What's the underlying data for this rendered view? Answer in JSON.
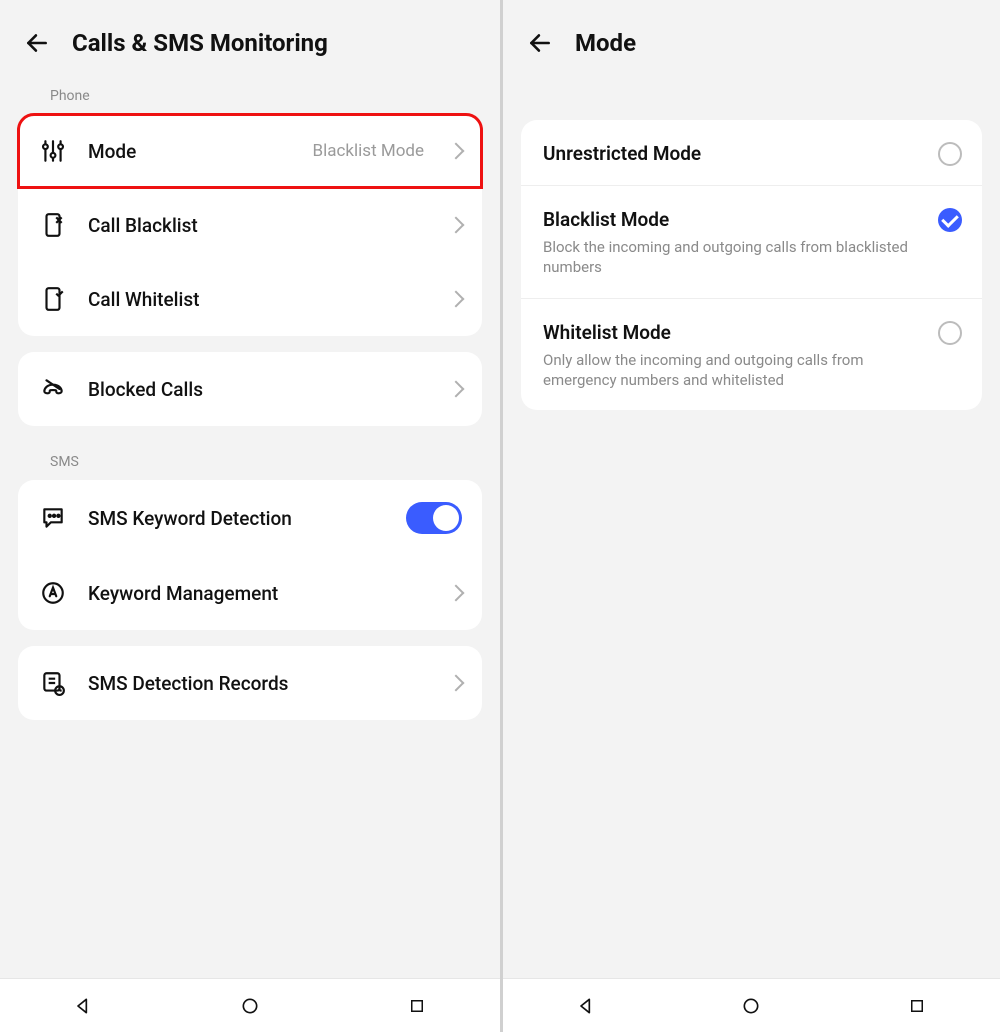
{
  "left": {
    "title": "Calls & SMS Monitoring",
    "sections": {
      "phone_label": "Phone",
      "sms_label": "SMS"
    },
    "rows": {
      "mode": {
        "label": "Mode",
        "value": "Blacklist Mode"
      },
      "call_blacklist": {
        "label": "Call Blacklist"
      },
      "call_whitelist": {
        "label": "Call Whitelist"
      },
      "blocked_calls": {
        "label": "Blocked Calls"
      },
      "sms_keyword": {
        "label": "SMS Keyword Detection",
        "toggle": true
      },
      "keyword_mgmt": {
        "label": "Keyword Management"
      },
      "sms_records": {
        "label": "SMS Detection Records"
      }
    }
  },
  "right": {
    "title": "Mode",
    "options": {
      "unrestricted": {
        "title": "Unrestricted Mode",
        "desc": "",
        "selected": false
      },
      "blacklist": {
        "title": "Blacklist Mode",
        "desc": "Block the incoming and outgoing calls from blacklisted numbers",
        "selected": true
      },
      "whitelist": {
        "title": "Whitelist Mode",
        "desc": "Only allow the incoming and outgoing calls from emergency numbers and whitelisted",
        "selected": false
      }
    }
  }
}
